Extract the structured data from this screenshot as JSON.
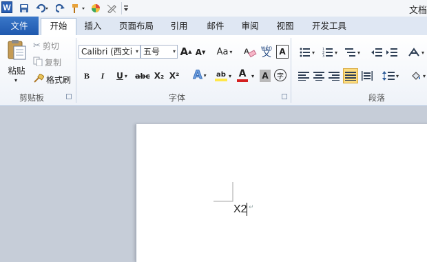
{
  "window": {
    "title": "文档",
    "app_logo": "W",
    "quick_access": [
      "save-icon",
      "undo-icon",
      "redo-icon",
      "format-painter-icon",
      "color-icon",
      "pen-icon",
      "customize-icon"
    ]
  },
  "tabs": [
    {
      "label": "文件"
    },
    {
      "label": "开始"
    },
    {
      "label": "插入"
    },
    {
      "label": "页面布局"
    },
    {
      "label": "引用"
    },
    {
      "label": "邮件"
    },
    {
      "label": "审阅"
    },
    {
      "label": "视图"
    },
    {
      "label": "开发工具"
    }
  ],
  "clipboard": {
    "paste": "粘贴",
    "cut": "剪切",
    "copy": "复制",
    "format_painter": "格式刷",
    "group_label": "剪贴板"
  },
  "font": {
    "font_name": "Calibri (西文i",
    "font_size": "五号",
    "grow": "A",
    "shrink": "A",
    "change_case": "Aa",
    "bold": "B",
    "italic": "I",
    "underline": "U",
    "strike": "abc",
    "subscript": "X₂",
    "superscript": "X²",
    "text_effect": "A",
    "highlight": "ab",
    "font_color": "A",
    "char_shading": "A",
    "enclose_char": "字",
    "clear_format_label": "A",
    "phonetic_label": "wén",
    "char_border": "A",
    "group_label": "字体"
  },
  "paragraph": {
    "group_label": "段落"
  },
  "document": {
    "text": "X2"
  },
  "colors": {
    "accent": "#2b5797",
    "file_tab": "#2a62b6",
    "highlight": "#ffd54a",
    "font_color_bar": "#d42020"
  }
}
